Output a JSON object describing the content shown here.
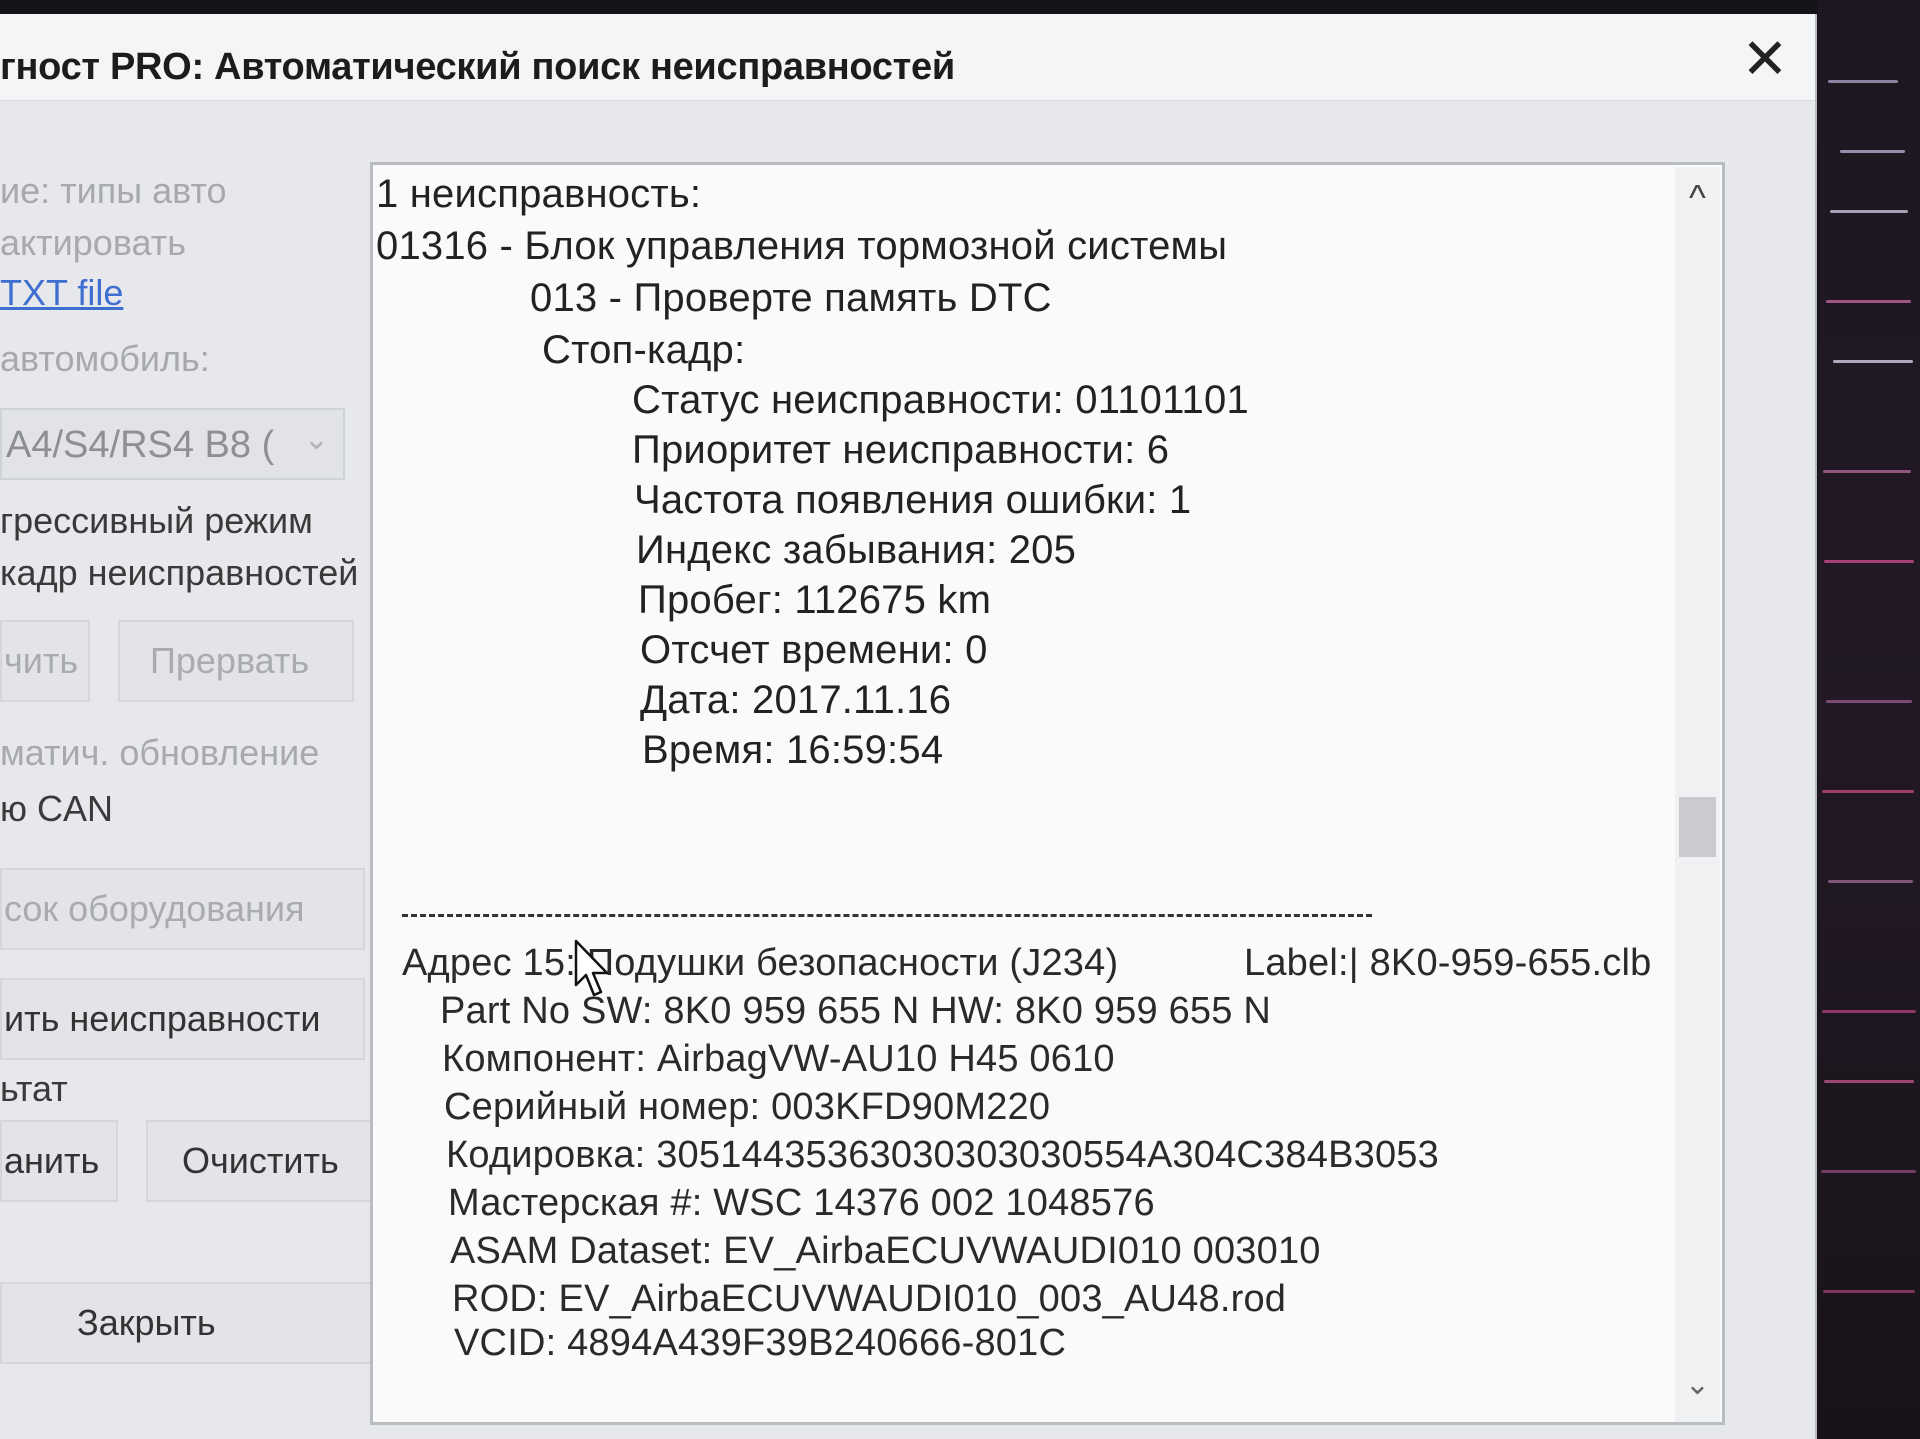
{
  "window": {
    "title": "гност PRO:  Автоматический поиск неисправностей",
    "close_glyph": "✕"
  },
  "left_panel": {
    "vehicle_types_label": "ие: типы авто",
    "edit_label": "актировать",
    "txt_file_link": "TXT file",
    "vehicle_label": "автомобиль:",
    "vehicle_select": {
      "value": "A4/S4/RS4 B8 (",
      "chevron": "⌄"
    },
    "aggressive_mode_label": "грессивный режим",
    "freeze_frame_label": "кадр неисправностей",
    "start_button": "чить",
    "abort_button": "Прервать",
    "auto_update_label": "матич. обновление",
    "can_label": "ю CAN",
    "equipment_list_button": "сок оборудования",
    "clear_faults_button": "ить неисправности",
    "result_label": "ьтат",
    "save_button": "анить",
    "clear_button": "Очистить",
    "close_button": "Закрыть"
  },
  "report": {
    "fault_count": "1 неисправность:",
    "fault_code": "01316 - Блок управления тормозной системы",
    "fault_subcode": "013 - Проверте память DTC",
    "freeze_frame_header": "Стоп-кадр:",
    "freeze_frame": [
      "Статус неисправности: 01101101",
      "Приоритет неисправности: 6",
      "Частота появления ошибки: 1",
      "Индекс забывания: 205",
      "Пробег: 112675 km",
      "Отсчет времени: 0",
      "Дата: 2017.11.16",
      "Время: 16:59:54"
    ],
    "separator": "---------------------------------------------------------------------",
    "address_line": "Адрес 15:  Подушки безопасности (J234)",
    "label_line": "Label:| 8K0-959-655.clb",
    "module_info": [
      "Part No SW: 8K0 959 655 N    HW: 8K0 959 655 N",
      "Компонент: AirbagVW-AU10 H45 0610",
      "Серийный номер: 003KFD90M220",
      "Кодировка: 30514435363030303030554A304C384B3053",
      "Мастерская #: WSC 14376 002 1048576",
      "ASAM Dataset: EV_AirbaECUVWAUDI010 003010",
      "ROD: EV_AirbaECUVWAUDI010_003_AU48.rod",
      "VCID: 4894A439F39B240666-801C"
    ]
  },
  "scrollbar": {
    "up_glyph": "^",
    "down_glyph": "⌄"
  }
}
